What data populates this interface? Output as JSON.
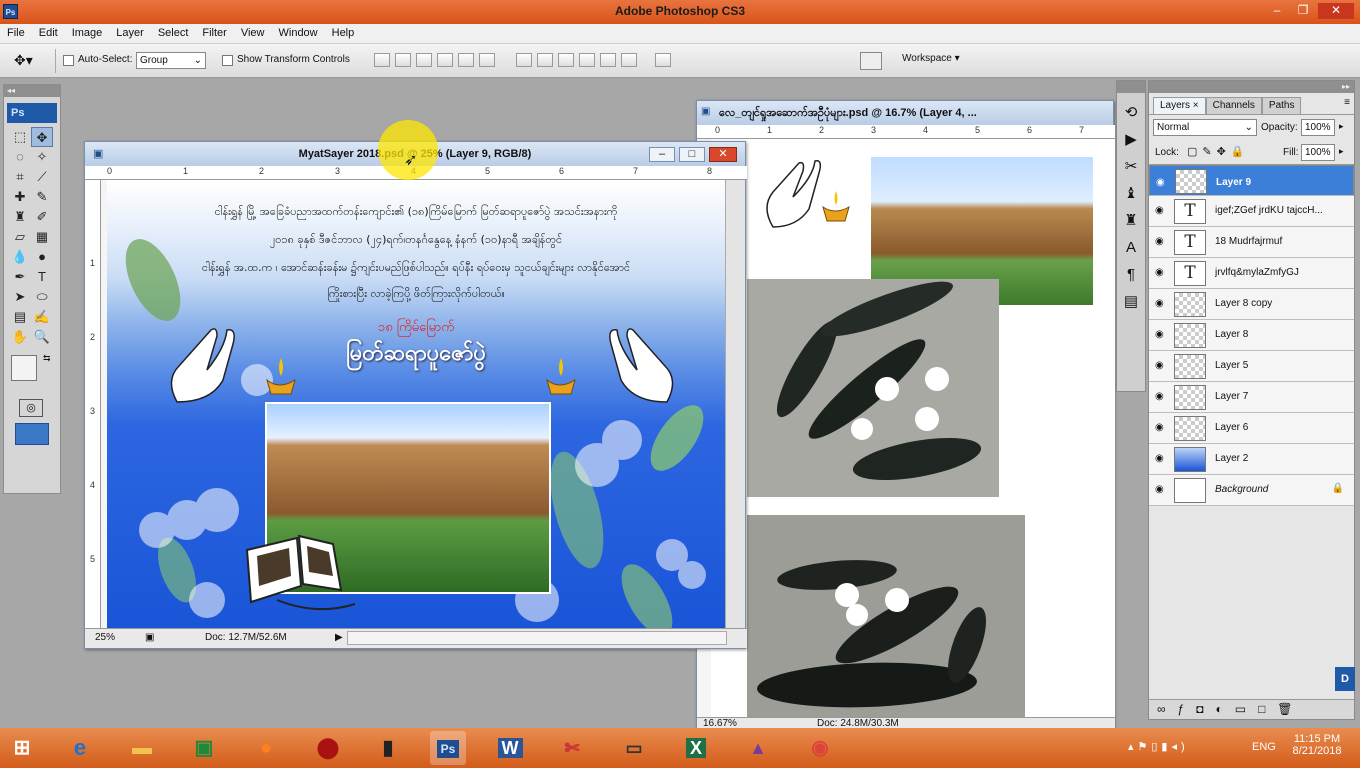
{
  "app": {
    "title": "Adobe Photoshop CS3",
    "logo": "Ps"
  },
  "menu": [
    "File",
    "Edit",
    "Image",
    "Layer",
    "Select",
    "Filter",
    "View",
    "Window",
    "Help"
  ],
  "options": {
    "auto_select_label": "Auto-Select:",
    "auto_select_value": "Group",
    "show_transform_label": "Show Transform Controls",
    "workspace_label": "Workspace ▾"
  },
  "doc1": {
    "title": "MyatSayer 2018.psd @ 25% (Layer 9, RGB/8)",
    "ruler_top": [
      "0",
      "1",
      "2",
      "3",
      "4",
      "5",
      "6",
      "7",
      "8"
    ],
    "ruler_left": [
      "1",
      "2",
      "3",
      "4",
      "5"
    ],
    "line1": "ငါန်းရွှန် မြို့ အခြေခံပညာအထက်တန်းကျောင်း၏ (၁၈)ကြိမ်မြောက် မြတ်ဆရာပူဇော်ပွဲ အသင်းအနားကို",
    "line2": "၂၀၁၈ ခုနှစ် ဒီဇင်ဘာလ (၂၄)ရက်၊တနင်္ဂနွေနေ့ နံနက် (၁၀)နာရီ အချိန်တွင်",
    "line3": "ငါန်းရွှန် အ.ထ.က ၊ အောင်ဆန်းခန်းမ ၌ကျင်းပမည်ဖြစ်ပါသည်။ ရပ်နီး ရပ်ဝေးမှ သူငယ်ချင်းများ လာနိုင်အောင်",
    "line4": "ကြိုးစားပြီး လာခဲ့ကြပို့ ဖိတ်ကြားလိုက်ပါတယ်။",
    "red_title": "၁၈ ကြိမ်မြောက်",
    "big_title": "မြတ်ဆရာပူဇော်ပွဲ",
    "zoom": "25%",
    "doc_size": "Doc: 12.7M/52.6M"
  },
  "doc2": {
    "title": "လေ_တျင်ရှုအဆောက်အဦပုံများ.psd @ 16.7% (Layer 4, ...",
    "ruler_top": [
      "0",
      "1",
      "2",
      "3",
      "4",
      "5",
      "6",
      "7"
    ],
    "zoom": "16.67%",
    "doc_size": "Doc: 24.8M/30.3M"
  },
  "layers_panel": {
    "tabs": [
      "Layers ×",
      "Channels",
      "Paths"
    ],
    "blend_mode": "Normal",
    "opacity_label": "Opacity:",
    "opacity_value": "100%",
    "lock_label": "Lock:",
    "fill_label": "Fill:",
    "fill_value": "100%",
    "rows": [
      {
        "name": "Layer 9",
        "thumb": "checker",
        "selected": true
      },
      {
        "name": "igef;ZGef jrdKU tajccH...",
        "thumb": "text",
        "selected": false
      },
      {
        "name": "18 Mudrfajrmuf",
        "thumb": "text",
        "selected": false
      },
      {
        "name": "jrvlfq&mylaZmfyGJ",
        "thumb": "text",
        "selected": false
      },
      {
        "name": "Layer 8 copy",
        "thumb": "checker",
        "selected": false
      },
      {
        "name": "Layer 8",
        "thumb": "checker",
        "selected": false
      },
      {
        "name": "Layer 5",
        "thumb": "checker",
        "selected": false
      },
      {
        "name": "Layer 7",
        "thumb": "checker",
        "selected": false
      },
      {
        "name": "Layer 6",
        "thumb": "checker",
        "selected": false
      },
      {
        "name": "Layer 2",
        "thumb": "blue",
        "selected": false
      },
      {
        "name": "Background",
        "thumb": "white",
        "selected": false
      }
    ],
    "text_thumb_glyph": "T"
  },
  "taskbar": {
    "time": "11:15 PM",
    "date": "8/21/2018",
    "lang": "ENG"
  },
  "colors": {
    "accent": "#3c7fd9",
    "titlebar": "#e07038",
    "poster_blue": "#1a55d8"
  }
}
